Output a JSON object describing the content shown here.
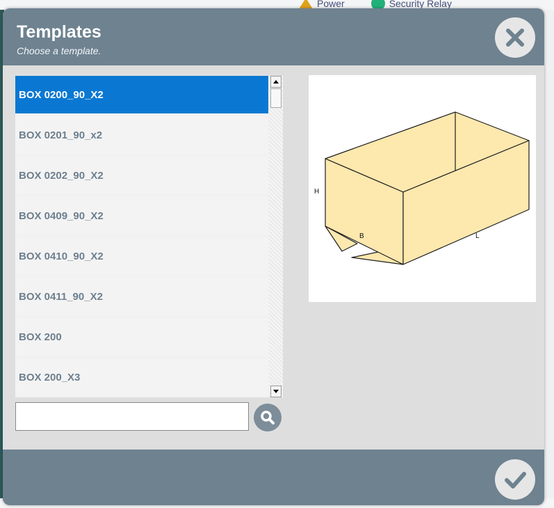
{
  "background": {
    "status_items": [
      {
        "label": "Power",
        "icon": "warning-icon"
      },
      {
        "label": "Security Relay",
        "icon": "check-circle-icon"
      }
    ]
  },
  "dialog": {
    "title": "Templates",
    "subtitle": "Choose a template.",
    "close_icon": "close-icon",
    "confirm_icon": "checkmark-icon"
  },
  "templates": {
    "selected_index": 0,
    "items": [
      {
        "label": "BOX 0200_90_X2"
      },
      {
        "label": "BOX 0201_90_x2"
      },
      {
        "label": "BOX 0202_90_X2"
      },
      {
        "label": "BOX 0409_90_X2"
      },
      {
        "label": "BOX 0410_90_X2"
      },
      {
        "label": "BOX 0411_90_X2"
      },
      {
        "label": "BOX 200"
      },
      {
        "label": "BOX 200_X3"
      }
    ]
  },
  "search": {
    "value": "",
    "placeholder": "",
    "icon": "search-icon"
  },
  "preview": {
    "labels": {
      "height": "H",
      "breadth": "B",
      "length": "L"
    },
    "fill_color": "#fde8ae"
  },
  "colors": {
    "header": "#6e8290",
    "selected": "#0a78d2",
    "item_text": "#6d7f8e"
  }
}
